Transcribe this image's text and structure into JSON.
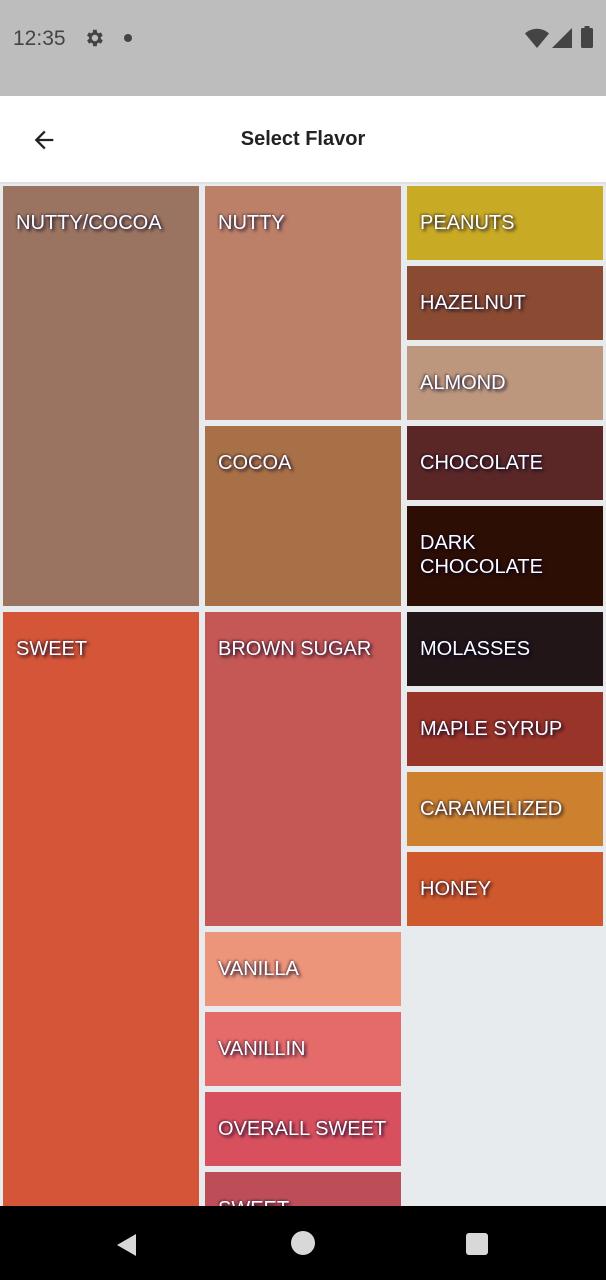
{
  "status_bar": {
    "time": "12:35"
  },
  "app_bar": {
    "title": "Select Flavor"
  },
  "colors": {
    "status_bg": "#bdbdbd",
    "app_bar_bg": "#ffffff",
    "treemap_bg": "#e8ebee",
    "nav_bg": "#000000"
  },
  "tiles": [
    {
      "id": "nutty-cocoa",
      "label": "NUTTY/COCOA",
      "color": "#9b7461"
    },
    {
      "id": "nutty",
      "label": "NUTTY",
      "color": "#bc7f68"
    },
    {
      "id": "cocoa",
      "label": "COCOA",
      "color": "#a87046"
    },
    {
      "id": "peanuts",
      "label": "PEANUTS",
      "color": "#c8aa25"
    },
    {
      "id": "hazelnut",
      "label": "HAZELNUT",
      "color": "#8b4b32"
    },
    {
      "id": "almond",
      "label": "ALMOND",
      "color": "#bd977d"
    },
    {
      "id": "chocolate",
      "label": "CHOCOLATE",
      "color": "#5a2726"
    },
    {
      "id": "dark-chocolate",
      "label": "DARK\nCHOCOLATE",
      "color": "#2d0e04"
    },
    {
      "id": "sweet",
      "label": "SWEET",
      "color": "#d45537"
    },
    {
      "id": "brown-sugar",
      "label": "BROWN SUGAR",
      "color": "#c55755"
    },
    {
      "id": "vanilla",
      "label": "VANILLA",
      "color": "#ec957a"
    },
    {
      "id": "vanillin",
      "label": "VANILLIN",
      "color": "#e56b6b"
    },
    {
      "id": "overall-sweet",
      "label": "OVERALL SWEET",
      "color": "#d8505e"
    },
    {
      "id": "sweet-aromatics",
      "label": "SWEET",
      "color": "#bd4e58"
    },
    {
      "id": "molasses",
      "label": "MOLASSES",
      "color": "#211517"
    },
    {
      "id": "maple-syrup",
      "label": "MAPLE  SYRUP",
      "color": "#993429"
    },
    {
      "id": "caramelized",
      "label": "CARAMELIZED",
      "color": "#cd812f"
    },
    {
      "id": "honey",
      "label": "HONEY",
      "color": "#cf582c"
    }
  ]
}
